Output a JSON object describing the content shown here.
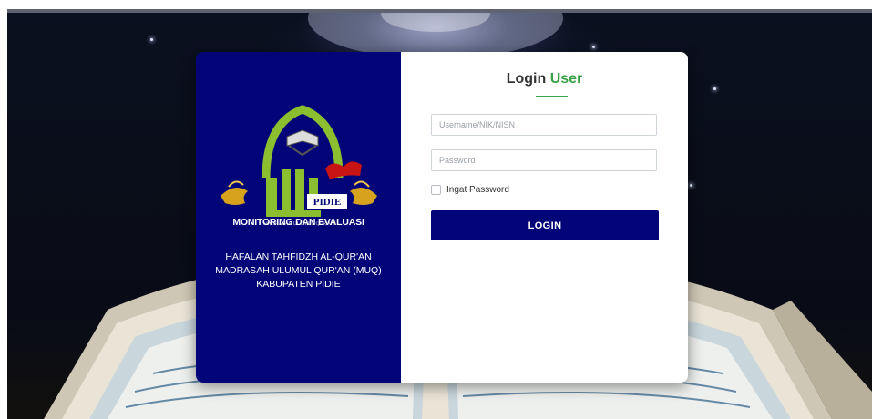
{
  "left_panel": {
    "logo_caption": "PIDIE",
    "logo_footer": "MADRASAH ULUMUL QUR'AN",
    "monitoring_title": "MONITORING DAN EVALUASI",
    "subtitle_lines": [
      "HAFALAN TAHFIDZH AL-QUR'AN",
      "MADRASAH ULUMUL QUR'AN (MUQ)",
      "KABUPATEN PIDIE"
    ]
  },
  "login": {
    "title_main": "Login",
    "title_accent": "User",
    "username_placeholder": "Username/NIK/NISN",
    "password_placeholder": "Password",
    "remember_label": "Ingat Password",
    "button_label": "LOGIN"
  },
  "colors": {
    "panel_blue": "#020477",
    "accent_green": "#3aa146"
  }
}
